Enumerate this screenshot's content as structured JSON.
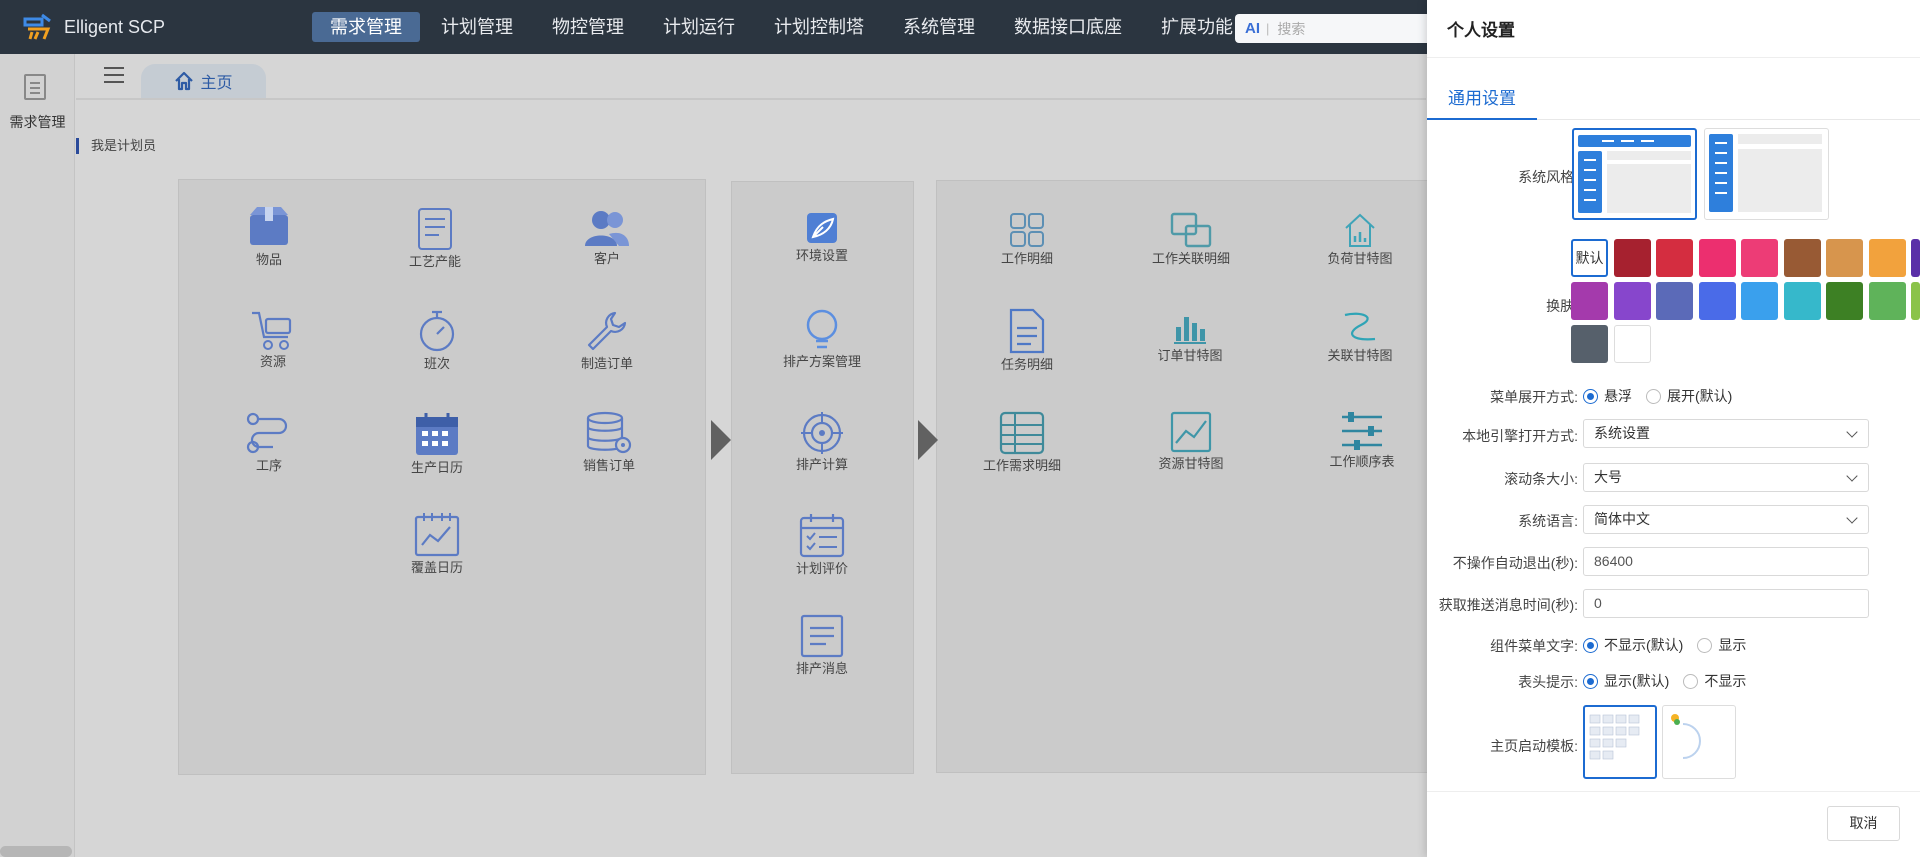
{
  "app": {
    "title": "Elligent SCP"
  },
  "nav": {
    "items": [
      {
        "label": "需求管理",
        "active": true
      },
      {
        "label": "计划管理"
      },
      {
        "label": "物控管理"
      },
      {
        "label": "计划运行"
      },
      {
        "label": "计划控制塔"
      },
      {
        "label": "系统管理"
      },
      {
        "label": "数据接口底座"
      },
      {
        "label": "扩展功能"
      }
    ]
  },
  "search": {
    "ai": "AI",
    "placeholder": "搜索"
  },
  "left": {
    "label": "需求管理"
  },
  "tab": {
    "label": "主页"
  },
  "role": "我是计划员",
  "panel1": [
    {
      "label": "物品",
      "icon": "box-icon"
    },
    {
      "label": "工艺产能",
      "icon": "document-icon"
    },
    {
      "label": "客户",
      "icon": "users-icon"
    },
    {
      "label": "资源",
      "icon": "cart-icon"
    },
    {
      "label": "班次",
      "icon": "stopwatch-icon"
    },
    {
      "label": "制造订单",
      "icon": "wrench-icon"
    },
    {
      "label": "工序",
      "icon": "route-icon"
    },
    {
      "label": "生产日历",
      "icon": "calendar-icon"
    },
    {
      "label": "销售订单",
      "icon": "database-gear-icon"
    },
    {
      "label": "覆盖日历",
      "icon": "chart-calendar-icon"
    }
  ],
  "panel2": [
    {
      "label": "环境设置",
      "icon": "leaf-icon"
    },
    {
      "label": "排产方案管理",
      "icon": "bulb-icon"
    },
    {
      "label": "排产计算",
      "icon": "target-icon"
    },
    {
      "label": "计划评价",
      "icon": "check-calendar-icon"
    },
    {
      "label": "排产消息",
      "icon": "message-icon"
    }
  ],
  "panel3": [
    {
      "label": "工作明细",
      "icon": "grid-icon"
    },
    {
      "label": "工作关联明细",
      "icon": "link-squares-icon"
    },
    {
      "label": "负荷甘特图",
      "icon": "house-chart-icon"
    },
    {
      "label": "任务明细",
      "icon": "file-icon"
    },
    {
      "label": "订单甘特图",
      "icon": "bar-chart-icon"
    },
    {
      "label": "关联甘特图",
      "icon": "curve-icon"
    },
    {
      "label": "工作需求明细",
      "icon": "table-icon"
    },
    {
      "label": "资源甘特图",
      "icon": "line-chart-icon"
    },
    {
      "label": "工作顺序表",
      "icon": "sliders-icon"
    }
  ],
  "drawer": {
    "title": "个人设置",
    "tab": "通用设置",
    "cancel": "取消",
    "fields": {
      "style": "系统风格:",
      "skin": "换肤:",
      "skin_default": "默认",
      "menu_mode": "菜单展开方式:",
      "menu_opt1": "悬浮",
      "menu_opt2": "展开(默认)",
      "engine": "本地引擎打开方式:",
      "engine_value": "系统设置",
      "scrollbar": "滚动条大小:",
      "scrollbar_value": "大号",
      "language": "系统语言:",
      "language_value": "简体中文",
      "autologout": "不操作自动退出(秒):",
      "autologout_value": "86400",
      "push": "获取推送消息时间(秒):",
      "push_value": "0",
      "widget_text": "组件菜单文字:",
      "widget_opt1": "不显示(默认)",
      "widget_opt2": "显示",
      "header_tip": "表头提示:",
      "header_opt1": "显示(默认)",
      "header_opt2": "不显示",
      "home_tpl": "主页启动模板:"
    },
    "skins": [
      "#a6212f",
      "#d42d40",
      "#ec2f6f",
      "#ed3c76",
      "#985a34",
      "#d7954d",
      "#f2a23d",
      "#5a2fa8",
      "#a43aac",
      "#8746cc",
      "#5b6ab8",
      "#4a6be8",
      "#3aa0ed",
      "#36b8cb",
      "#3d8024",
      "#5fb35a",
      "#8bc34a",
      "#56606b",
      "#ffffff"
    ]
  }
}
